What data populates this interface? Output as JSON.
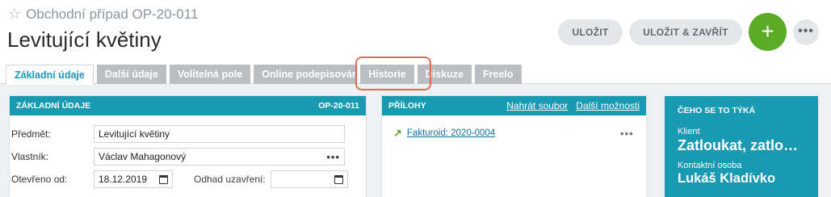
{
  "header": {
    "subtitle": "Obchodní případ  OP-20-011",
    "title": "Levitující květiny",
    "save_label": "ULOŽIT",
    "save_close_label": "ULOŽIT & ZAVŘÍT",
    "add_label": "+",
    "more_label": "•••"
  },
  "tabs": [
    {
      "label": "Základní údaje",
      "active": true
    },
    {
      "label": "Další údaje"
    },
    {
      "label": "Volitelná pole"
    },
    {
      "label": "Online podepisování"
    },
    {
      "label": "Historie"
    },
    {
      "label": "Diskuze"
    },
    {
      "label": "Freelo"
    }
  ],
  "basic": {
    "header_title": "ZÁKLADNÍ ÚDAJE",
    "header_code": "OP-20-011",
    "subject_label": "Předmět:",
    "subject_value": "Levitující květiny",
    "owner_label": "Vlastník:",
    "owner_value": "Václav Mahagonový",
    "opened_label": "Otevřeno od:",
    "opened_value": "18.12.2019",
    "estimate_label": "Odhad uzavření:",
    "estimate_value": ""
  },
  "attachments": {
    "header_title": "PŘÍLOHY",
    "upload_label": "Nahrát soubor",
    "more_options_label": "Další možnosti",
    "items": [
      {
        "label": "Fakturoid: 2020-0004"
      }
    ]
  },
  "side": {
    "title": "ČEHO SE TO TÝKÁ",
    "client_label": "Klient",
    "client_value": "Zatloukat, zatloukat",
    "contact_label": "Kontaktní osoba",
    "contact_value": "Lukáš Kladívko"
  },
  "colors": {
    "accent": "#1a9ab2",
    "add_button": "#5cab26",
    "highlight": "#e06b55"
  }
}
